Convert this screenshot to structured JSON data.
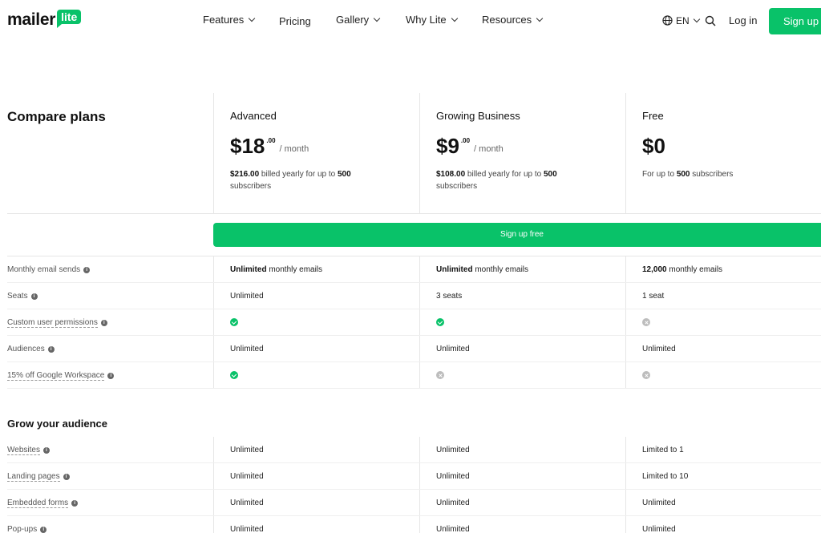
{
  "brand": {
    "word": "mailer",
    "badge": "lite"
  },
  "nav": {
    "features": "Features",
    "pricing": "Pricing",
    "gallery": "Gallery",
    "why_lite": "Why Lite",
    "resources": "Resources",
    "lang": "EN",
    "login": "Log in",
    "signup": "Sign up"
  },
  "compare_title": "Compare plans",
  "plans": [
    {
      "name": "Advanced",
      "price": "$18",
      "cents": ".00",
      "per": "/ month",
      "note_amount": "$216.00",
      "note_mid": " billed yearly for up to ",
      "note_subs": "500",
      "note_tail": " subscribers"
    },
    {
      "name": "Growing Business",
      "price": "$9",
      "cents": ".00",
      "per": "/ month",
      "note_amount": "$108.00",
      "note_mid": " billed yearly for up to ",
      "note_subs": "500",
      "note_tail": " subscribers"
    },
    {
      "name": "Free",
      "price": "$0",
      "note_pre": "For up to ",
      "note_subs": "500",
      "note_tail": " subscribers"
    }
  ],
  "cta": "Sign up free",
  "rows": [
    {
      "label": "Monthly email sends",
      "cells": [
        {
          "bold": "Unlimited",
          "text": " monthly emails"
        },
        {
          "bold": "Unlimited",
          "text": " monthly emails"
        },
        {
          "bold": "12,000",
          "text": " monthly emails"
        }
      ]
    },
    {
      "label": "Seats",
      "cells": [
        {
          "text": "Unlimited"
        },
        {
          "text": "3 seats"
        },
        {
          "text": "1 seat"
        }
      ]
    },
    {
      "label": "Custom user permissions",
      "cells": [
        {
          "icon": "check"
        },
        {
          "icon": "check"
        },
        {
          "icon": "cross"
        }
      ]
    },
    {
      "label": "Audiences",
      "cells": [
        {
          "text": "Unlimited"
        },
        {
          "text": "Unlimited"
        },
        {
          "text": "Unlimited"
        }
      ]
    },
    {
      "label": "15% off Google Workspace",
      "cells": [
        {
          "icon": "check"
        },
        {
          "icon": "cross"
        },
        {
          "icon": "cross"
        }
      ]
    }
  ],
  "section2": {
    "title": "Grow your audience",
    "rows": [
      {
        "label": "Websites",
        "cells": [
          {
            "text": "Unlimited"
          },
          {
            "text": "Unlimited"
          },
          {
            "text": "Limited to 1"
          }
        ]
      },
      {
        "label": "Landing pages",
        "cells": [
          {
            "text": "Unlimited"
          },
          {
            "text": "Unlimited"
          },
          {
            "text": "Limited to 10"
          }
        ]
      },
      {
        "label": "Embedded forms",
        "cells": [
          {
            "text": "Unlimited"
          },
          {
            "text": "Unlimited"
          },
          {
            "text": "Unlimited"
          }
        ]
      },
      {
        "label": "Pop-ups",
        "cells": [
          {
            "text": "Unlimited"
          },
          {
            "text": "Unlimited"
          },
          {
            "text": "Unlimited"
          }
        ]
      }
    ]
  },
  "colors": {
    "accent": "#09c269",
    "muted": "#bdbdbd"
  },
  "icons": {
    "globe": "globe-icon",
    "search": "search-icon",
    "check": "check-icon",
    "cross": "cross-icon",
    "info": "info-icon"
  }
}
